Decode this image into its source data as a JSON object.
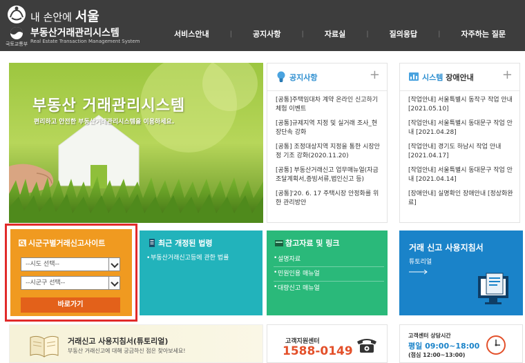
{
  "header": {
    "slogan_small": "내 손안에",
    "slogan_big": "서울",
    "seal_label": "국토교통부",
    "site_title": "부동산거래관리시스템",
    "site_title_en": "Real Estate Transaction Management System",
    "nav": [
      "서비스안내",
      "공지사항",
      "자료실",
      "질의응답",
      "자주하는 질문"
    ]
  },
  "hero": {
    "title": "부동산 거래관리시스템",
    "subtitle": "편리하고 안전한 부동산거래관리시스템을 이용하세요."
  },
  "notice": {
    "title": "공지사항",
    "plus": "+",
    "items": [
      "[공통]주택임대차 계약 온라인 신고하기 체험 이벤트",
      "[공통]규제지역 지정 및 실거래 조사_현장단속 강화",
      "[공통] 조정대상지역 지정을 통한 시장안정 기조 강화(2020.11.20)",
      "[공통] 부동산거래신고 업무매뉴얼(자금조달계획서,증빙서류,법인신고 등)",
      "[공통]'20. 6. 17 주택시장 안정화를 위한 관리방안"
    ]
  },
  "system": {
    "title_hl": "시스템",
    "title_rest": " 장애안내",
    "plus": "+",
    "items": [
      "[작업안내] 서울특별시 동작구 작업 안내 [2021.05.10]",
      "[작업안내] 서울특별시 동대문구 작업 안내 [2021.04.28]",
      "[작업안내] 경기도 하남시 작업 안내 [2021.04.17]",
      "[작업안내] 서울특별시 동대문구 작업 안내 [2021.04.14]",
      "[장애안내] 실명확인 장애안내 [정상화완료]"
    ]
  },
  "region": {
    "title": "시군구별거래신고사이트",
    "sido_placeholder": "--시도 선택--",
    "sigungu_placeholder": "--시군구 선택--",
    "go_label": "바로가기"
  },
  "laws": {
    "title": "최근 개정된 법령",
    "items": [
      "부동산거래신고등에 관한 법률"
    ]
  },
  "refs": {
    "title": "참고자료 및 링크",
    "items": [
      "설명자료",
      "민원인용 매뉴얼",
      "대량신고 매뉴얼"
    ]
  },
  "guide": {
    "title": "거래 신고 사용지침서",
    "sub": "튜토리얼"
  },
  "tutorial": {
    "title": "거래신고 사용지침서(튜토리얼)",
    "sub": "부동산 거래신고에 대해 궁금하신 점은 찾아보세요!"
  },
  "callcenter": {
    "label": "고객지원센터",
    "phone": "1588-0149"
  },
  "hours": {
    "label": "고객센터 상담시간",
    "weekday_label": "평일",
    "weekday": "09:00~18:00",
    "lunch": "(점심 12:00~13:00)"
  },
  "colors": {
    "header": "#3d3d3d",
    "orange": "#f09a20",
    "teal": "#22b3bb",
    "green": "#2ab97a",
    "blue": "#1a83c9",
    "red_outline": "#e12a2a"
  }
}
